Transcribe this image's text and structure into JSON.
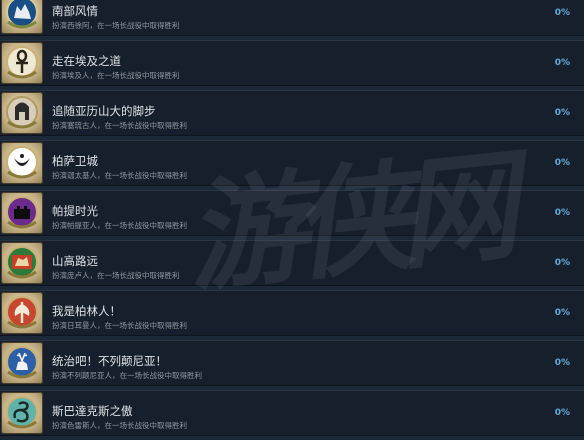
{
  "watermark_text": "游侠网",
  "achievements": [
    {
      "title": "南部风情",
      "desc": "扮演西徐阿，在一场长战役中取得胜利",
      "pct": "0%",
      "icon": "wolf-icon",
      "icon_bg": "#1a4f86"
    },
    {
      "title": "走在埃及之道",
      "desc": "扮演埃及人，在一场长战役中取得胜利",
      "pct": "0%",
      "icon": "ankh-icon",
      "icon_bg": "#e9e2cc"
    },
    {
      "title": "追随亚历山大的脚步",
      "desc": "扮演塞琉古人，在一场长战役中取得胜利",
      "pct": "0%",
      "icon": "helmet-icon",
      "icon_bg": "#cfc5b0"
    },
    {
      "title": "柏萨卫城",
      "desc": "扮演迦太基人，在一场长战役中取得胜利",
      "pct": "0%",
      "icon": "crescent-icon",
      "icon_bg": "#ffffff"
    },
    {
      "title": "帕提时光",
      "desc": "扮演帕提亚人，在一场长战役中取得胜利",
      "pct": "0%",
      "icon": "castle-icon",
      "icon_bg": "#6b2a8c"
    },
    {
      "title": "山高路远",
      "desc": "扮演庞卢人，在一场长战役中取得胜利",
      "pct": "0%",
      "icon": "beast-icon",
      "icon_bg": "#2e7a3a"
    },
    {
      "title": "我是柏林人！",
      "desc": "扮演日耳曼人，在一场长战役中取得胜利",
      "pct": "0%",
      "icon": "axe-icon",
      "icon_bg": "#c8452f"
    },
    {
      "title": "统治吧！不列颠尼亚！",
      "desc": "扮演不列颠尼亚人，在一场长战役中取得胜利",
      "pct": "0%",
      "icon": "stag-icon",
      "icon_bg": "#2b5fa8"
    },
    {
      "title": "斯巴達克斯之傲",
      "desc": "扮演色雷斯人，在一场长战役中取得胜利",
      "pct": "0%",
      "icon": "serpent-icon",
      "icon_bg": "#5fb3a8"
    }
  ]
}
